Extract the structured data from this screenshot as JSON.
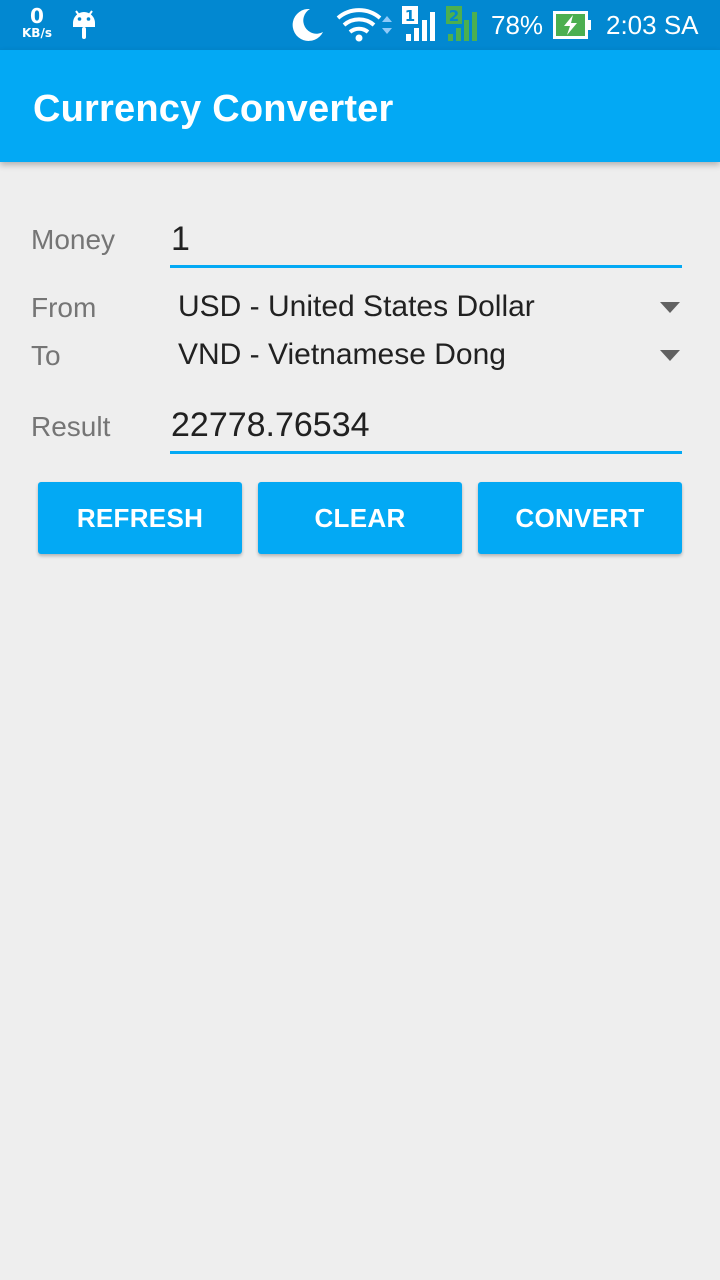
{
  "status_bar": {
    "net_speed": "0",
    "net_speed_unit": "KB/s",
    "battery_percent": "78%",
    "time": "2:03 SA",
    "sim1_label": "1",
    "sim2_label": "2",
    "icons": [
      "android-debug-icon",
      "moon-icon",
      "wifi-icon",
      "signal-sim1-icon",
      "signal-sim2-icon",
      "battery-charging-icon"
    ]
  },
  "app_bar": {
    "title": "Currency Converter"
  },
  "form": {
    "money_label": "Money",
    "money_value": "1",
    "from_label": "From",
    "from_value": "USD - United States Dollar",
    "to_label": "To",
    "to_value": "VND - Vietnamese Dong",
    "result_label": "Result",
    "result_value": "22778.76534"
  },
  "buttons": {
    "refresh": "REFRESH",
    "clear": "CLEAR",
    "convert": "CONVERT"
  },
  "colors": {
    "status_bar": "#0288d1",
    "primary": "#03a9f4",
    "background": "#eeeeee"
  }
}
